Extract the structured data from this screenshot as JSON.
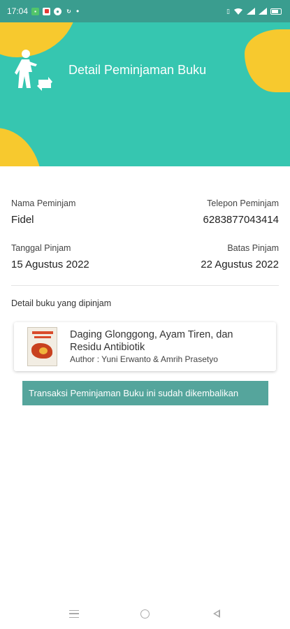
{
  "status_bar": {
    "time": "17:04",
    "icons": [
      "notification-icon",
      "app-icon",
      "app-icon",
      "app-icon",
      "dot-icon",
      "vibrate-icon",
      "wifi-icon",
      "signal-icon",
      "signal-icon",
      "battery-icon"
    ]
  },
  "header": {
    "title": "Detail Peminjaman Buku",
    "icon": "person-exchange-icon",
    "colors": {
      "background": "#36c6b0",
      "accent": "#f7c92e"
    }
  },
  "borrower": {
    "name_label": "Nama Peminjam",
    "name_value": "Fidel",
    "phone_label": "Telepon Peminjam",
    "phone_value": "6283877043414"
  },
  "dates": {
    "borrow_label": "Tanggal Pinjam",
    "borrow_value": "15 Agustus 2022",
    "due_label": "Batas Pinjam",
    "due_value": "22 Agustus 2022"
  },
  "books": {
    "section_label": "Detail buku yang dipinjam",
    "items": [
      {
        "title": "Daging Glonggong, Ayam Tiren, dan Residu Antibiotik",
        "author": "Author : Yuni Erwanto & Amrih Prasetyo"
      }
    ]
  },
  "status_banner": {
    "text": "Transaksi Peminjaman Buku ini sudah dikembalikan",
    "color": "#55a59c"
  },
  "nav_bar": {
    "icons": [
      "menu-icon",
      "home-icon",
      "back-icon"
    ]
  }
}
